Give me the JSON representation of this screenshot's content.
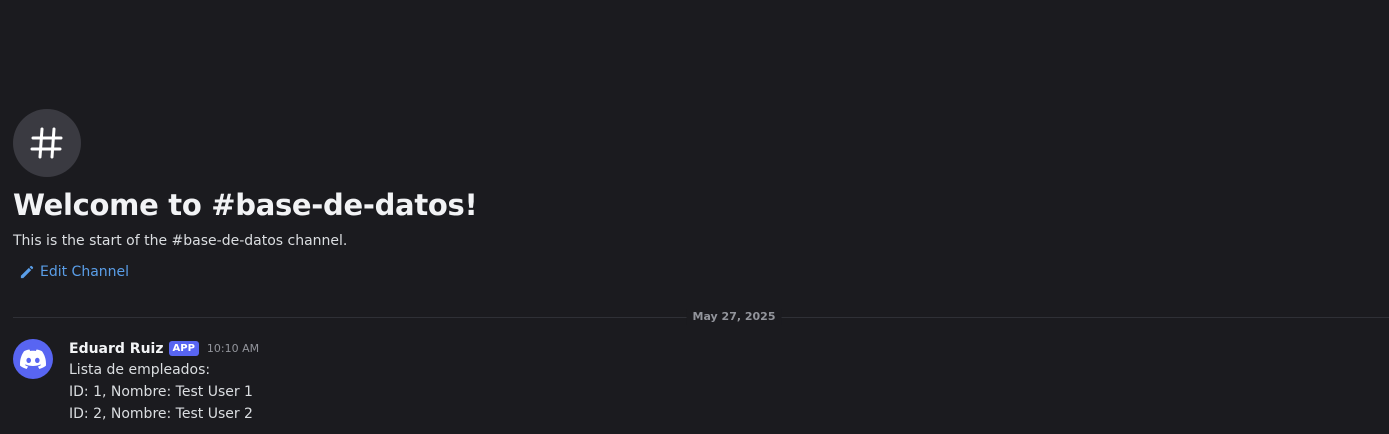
{
  "channel": {
    "welcome_title": "Welcome to #base-de-datos!",
    "welcome_subtitle": "This is the start of the #base-de-datos channel.",
    "edit_label": "Edit Channel",
    "badge_icon": "hashtag-icon"
  },
  "divider": {
    "date": "May 27, 2025"
  },
  "message": {
    "author": "Eduard Ruiz",
    "tag": "APP",
    "timestamp": "10:10 AM",
    "avatar_icon": "discord-logo-icon",
    "lines": [
      "Lista de empleados:",
      "ID: 1, Nombre: Test User 1",
      "ID: 2, Nombre: Test User 2"
    ]
  },
  "colors": {
    "background": "#1b1b1f",
    "accent": "#5865f2",
    "link": "#5a9ee8"
  }
}
